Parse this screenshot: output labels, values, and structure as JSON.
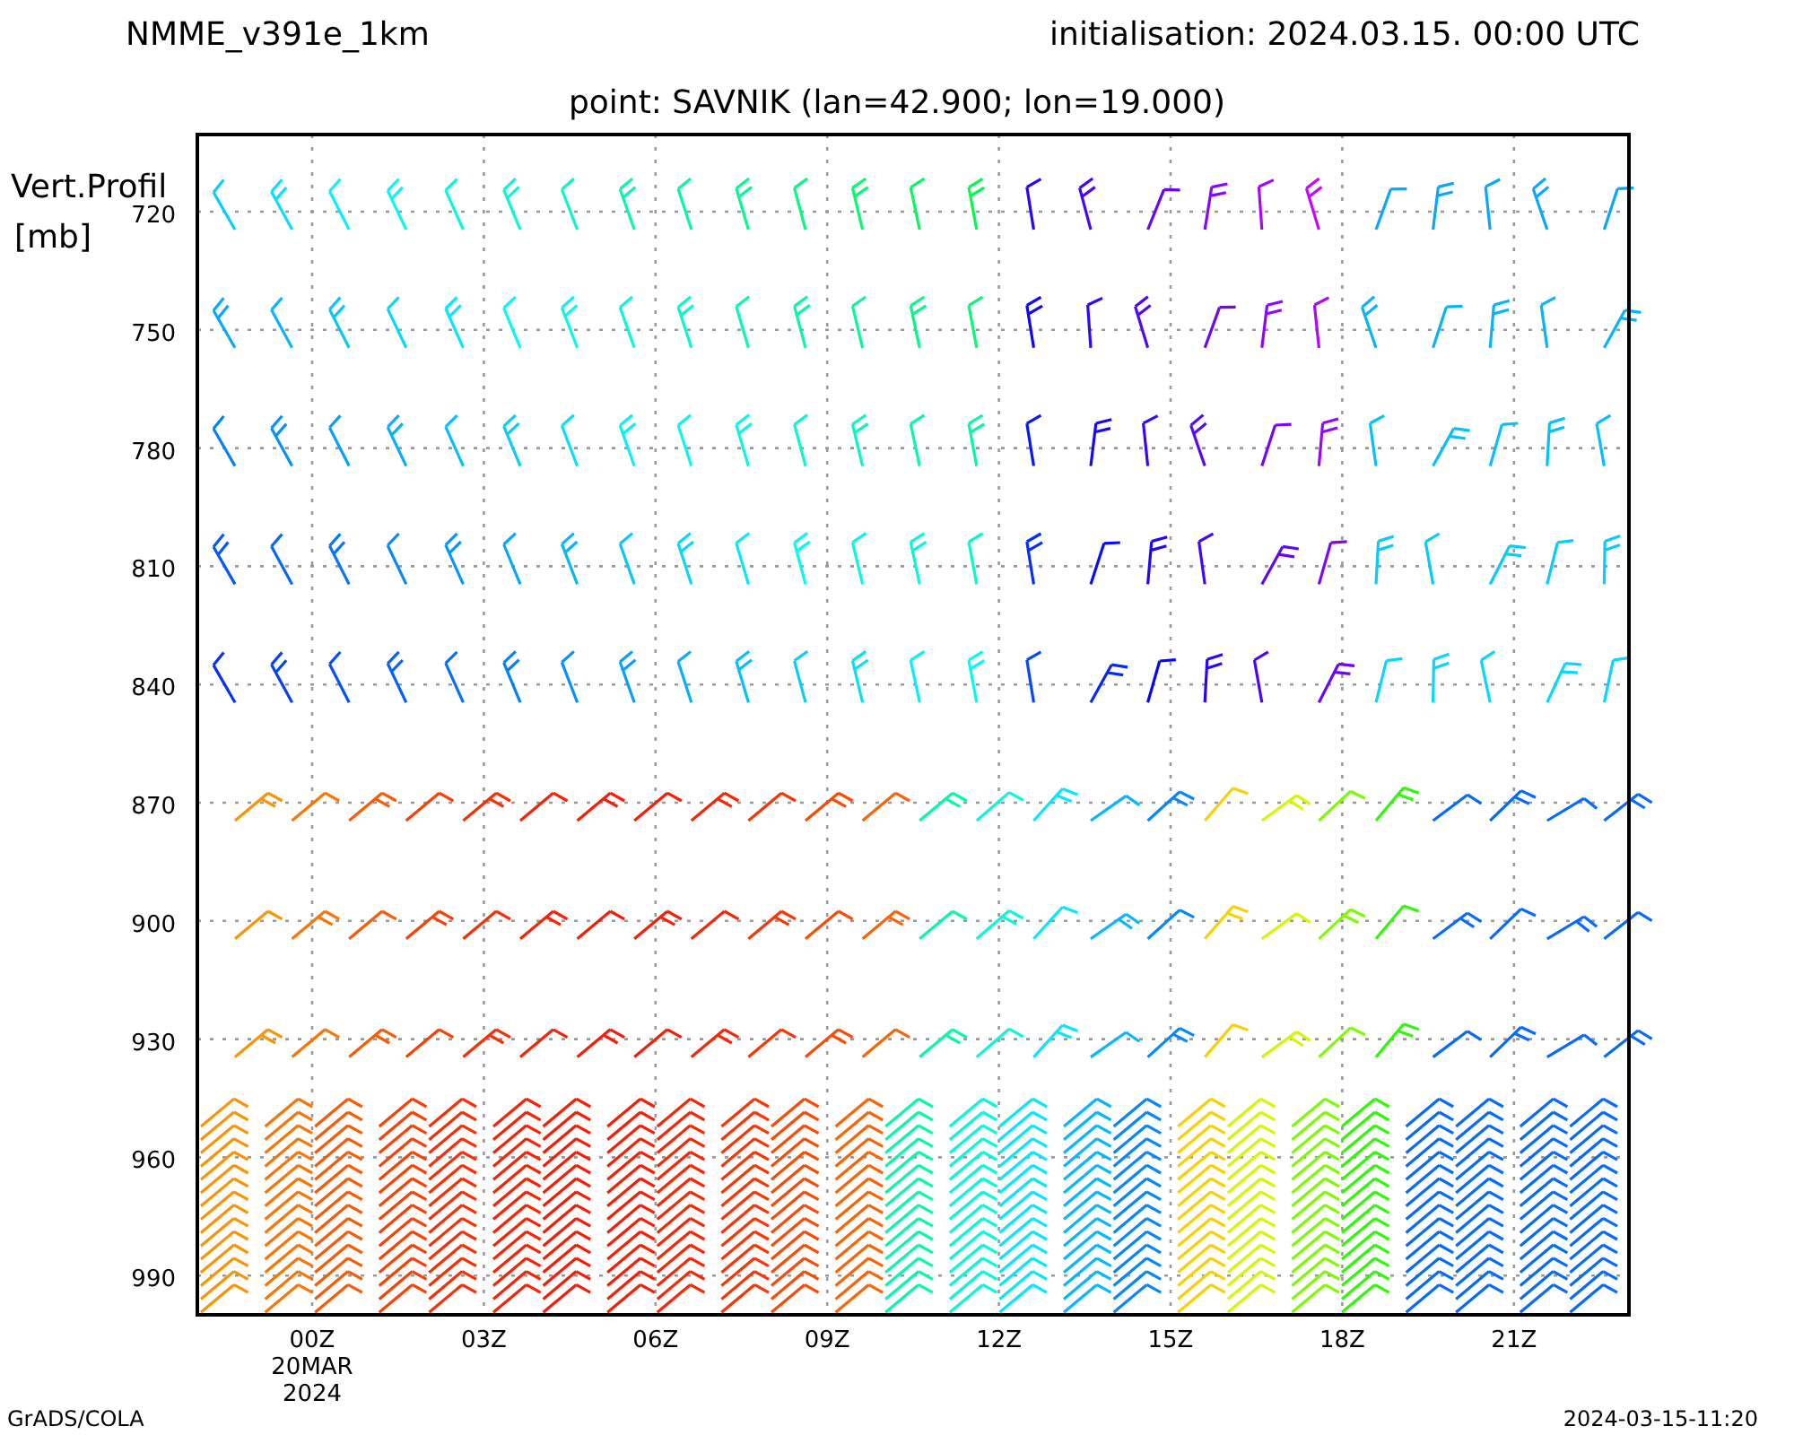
{
  "header": {
    "model": "NMME_v391e_1km",
    "initialisation": "initialisation: 2024.03.15. 00:00 UTC",
    "point": "point: SAVNIK (lan=42.900; lon=19.000)"
  },
  "axis": {
    "y_title": [
      "Vert.Profil",
      "[mb]"
    ],
    "y_labels": [
      "720",
      "750",
      "780",
      "810",
      "840",
      "870",
      "900",
      "930",
      "960",
      "990"
    ],
    "x_labels": [
      "00Z",
      "03Z",
      "06Z",
      "09Z",
      "12Z",
      "15Z",
      "18Z",
      "21Z"
    ],
    "x_sublabels": [
      "20MAR",
      "2024"
    ]
  },
  "footer": {
    "left": "GrADS/COLA",
    "right": "2024-03-15-11:20"
  }
}
